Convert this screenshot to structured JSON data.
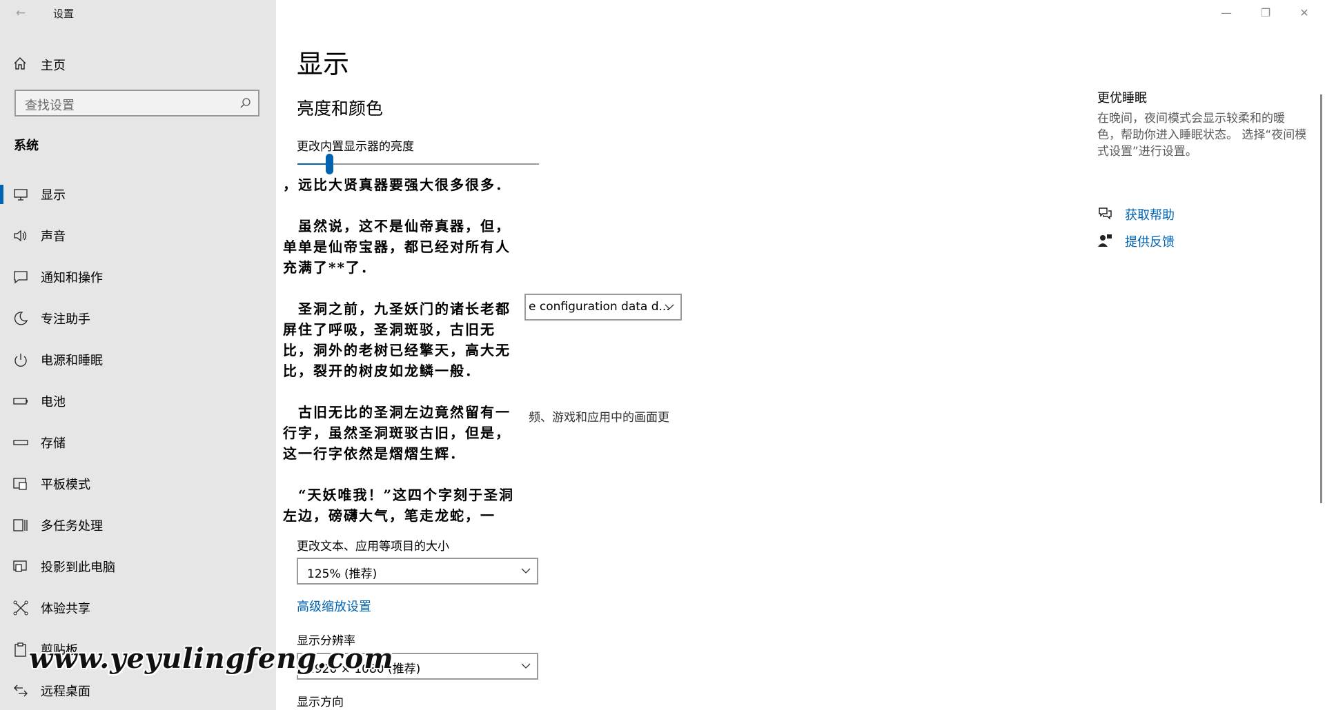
{
  "window": {
    "title": "设置",
    "controls": {
      "minimize": "—",
      "restore": "❐",
      "close": "✕"
    }
  },
  "sidebar": {
    "home_label": "主页",
    "search_placeholder": "查找设置",
    "section_title": "系统",
    "items": [
      {
        "label": "显示",
        "icon": "monitor-icon",
        "active": true
      },
      {
        "label": "声音",
        "icon": "speaker-icon"
      },
      {
        "label": "通知和操作",
        "icon": "message-icon"
      },
      {
        "label": "专注助手",
        "icon": "moon-icon"
      },
      {
        "label": "电源和睡眠",
        "icon": "power-icon"
      },
      {
        "label": "电池",
        "icon": "battery-icon"
      },
      {
        "label": "存储",
        "icon": "storage-icon"
      },
      {
        "label": "平板模式",
        "icon": "tablet-icon"
      },
      {
        "label": "多任务处理",
        "icon": "multitask-icon"
      },
      {
        "label": "投影到此电脑",
        "icon": "project-icon"
      },
      {
        "label": "体验共享",
        "icon": "share-icon"
      },
      {
        "label": "剪贴板",
        "icon": "clipboard-icon"
      },
      {
        "label": "远程桌面",
        "icon": "remote-icon"
      }
    ]
  },
  "main": {
    "page_title": "显示",
    "brightness_section_title": "亮度和颜色",
    "brightness_label": "更改内置显示器的亮度",
    "brightness_level": 0.13,
    "profile_dropdown_partial": "e configuration data d...",
    "hdr_partial_text": "频、游戏和应用中的画面更",
    "scale_label": "更改文本、应用等项目的大小",
    "scale_value": "125% (推荐)",
    "advanced_scaling_link": "高级缩放设置",
    "resolution_label": "显示分辨率",
    "resolution_value": "1920 × 1080 (推荐)",
    "orientation_label": "显示方向"
  },
  "overlay": {
    "paragraphs": [
      "，远比大贤真器要强大很多很多．",
      "　虽然说，这不是仙帝真器，但，单单是仙帝宝器，都已经对所有人充满了**了．",
      "　圣洞之前，九圣妖门的诸长老都屏住了呼吸，圣洞斑驳，古旧无比，洞外的老树已经擎天，高大无比，裂开的树皮如龙鳞一般．",
      "　古旧无比的圣洞左边竟然留有一行字，虽然圣洞斑驳古旧，但是，这一行字依然是熠熠生辉．",
      "　“天妖唯我！”这四个字刻于圣洞左边，磅礴大气，笔走龙蛇，一"
    ]
  },
  "right_panel": {
    "sleep_title": "更优睡眠",
    "sleep_desc": "在晚间，夜间模式会显示较柔和的暖色，帮助你进入睡眠状态。 选择“夜间模式设置”进行设置。",
    "help_link": "获取帮助",
    "feedback_link": "提供反馈"
  },
  "watermark": "www.yeyulingfeng.com",
  "colors": {
    "accent": "#0063b1",
    "sidebar_bg": "#e6e6e6"
  }
}
